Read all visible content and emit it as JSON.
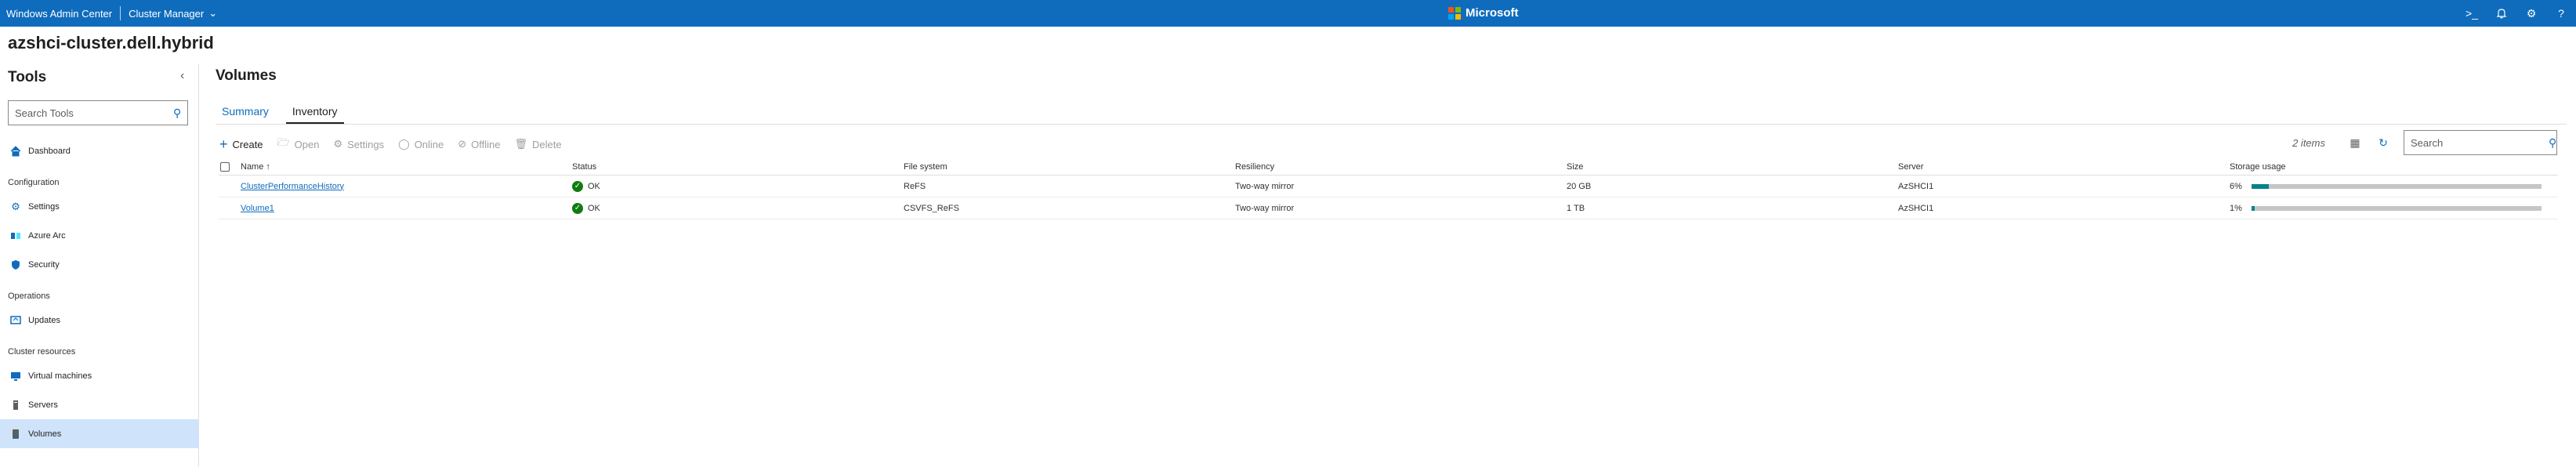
{
  "topbar": {
    "app_name": "Windows Admin Center",
    "context_label": "Cluster Manager",
    "brand": "Microsoft",
    "colors": {
      "bar": "#0f6cbd",
      "logo_red": "#f25022",
      "logo_green": "#7fba00",
      "logo_blue": "#00a4ef",
      "logo_yellow": "#ffb900"
    },
    "icons": [
      "powershell-icon",
      "bell-icon",
      "gear-icon",
      "help-icon"
    ]
  },
  "cluster_title": "azshci-cluster.dell.hybrid",
  "sidebar": {
    "heading": "Tools",
    "search_placeholder": "Search Tools",
    "groups": [
      {
        "items": [
          {
            "label": "Dashboard",
            "icon": "home-icon"
          }
        ]
      },
      {
        "label": "Configuration",
        "items": [
          {
            "label": "Settings",
            "icon": "gear-icon"
          },
          {
            "label": "Azure Arc",
            "icon": "azure-arc-icon"
          },
          {
            "label": "Security",
            "icon": "shield-icon"
          }
        ]
      },
      {
        "label": "Operations",
        "items": [
          {
            "label": "Updates",
            "icon": "updates-icon"
          }
        ]
      },
      {
        "label": "Cluster resources",
        "items": [
          {
            "label": "Virtual machines",
            "icon": "monitor-icon"
          },
          {
            "label": "Servers",
            "icon": "server-icon"
          },
          {
            "label": "Volumes",
            "icon": "volume-icon",
            "active": true
          }
        ]
      }
    ]
  },
  "main": {
    "title": "Volumes",
    "tabs": [
      {
        "label": "Summary"
      },
      {
        "label": "Inventory",
        "active": true
      }
    ],
    "toolbar": {
      "create": "Create",
      "open": "Open",
      "settings": "Settings",
      "online": "Online",
      "offline": "Offline",
      "delete": "Delete"
    },
    "items_count": "2 items",
    "search_placeholder": "Search",
    "table": {
      "headers": {
        "name": "Name ↑",
        "status": "Status",
        "file_system": "File system",
        "resiliency": "Resiliency",
        "size": "Size",
        "server": "Server",
        "storage_usage": "Storage usage"
      },
      "rows": [
        {
          "name": "ClusterPerformanceHistory",
          "status": "OK",
          "file_system": "ReFS",
          "resiliency": "Two-way mirror",
          "size": "20 GB",
          "server": "AzSHCI1",
          "usage_label": "6%",
          "usage_fraction": 0.06
        },
        {
          "name": "Volume1",
          "status": "OK",
          "file_system": "CSVFS_ReFS",
          "resiliency": "Two-way mirror",
          "size": "1 TB",
          "server": "AzSHCI1",
          "usage_label": "1%",
          "usage_fraction": 0.01
        }
      ]
    }
  }
}
